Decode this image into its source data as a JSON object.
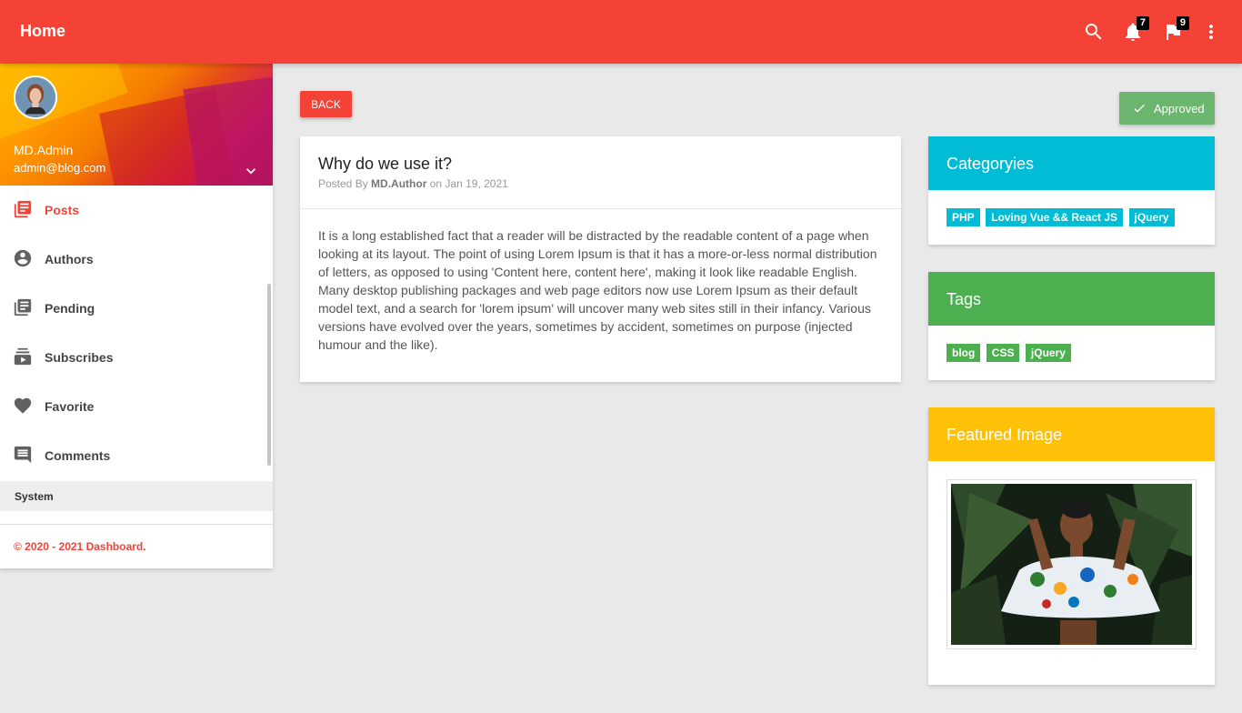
{
  "header": {
    "title": "Home",
    "notifications_count": "7",
    "flags_count": "9",
    "color": "#f44336"
  },
  "user": {
    "name": "MD.Admin",
    "email": "admin@blog.com"
  },
  "sidebar": {
    "items": [
      {
        "label": "Posts",
        "icon": "posts-icon",
        "active": true
      },
      {
        "label": "Authors",
        "icon": "account-circle-icon"
      },
      {
        "label": "Pending",
        "icon": "pending-icon"
      },
      {
        "label": "Subscribes",
        "icon": "subscriptions-icon"
      },
      {
        "label": "Favorite",
        "icon": "heart-icon"
      },
      {
        "label": "Comments",
        "icon": "comment-icon"
      }
    ],
    "section_header": "System",
    "footer": "© 2020 - 2021 Dashboard."
  },
  "actions": {
    "back_label": "BACK",
    "approved_label": "Approved"
  },
  "post": {
    "title": "Why do we use it?",
    "meta_prefix": "Posted By",
    "author": "MD.Author",
    "meta_on": "on",
    "date": "Jan 19, 2021",
    "body": "It is a long established fact that a reader will be distracted by the readable content of a page when looking at its layout. The point of using Lorem Ipsum is that it has a more-or-less normal distribution of letters, as opposed to using 'Content here, content here', making it look like readable English. Many desktop publishing packages and web page editors now use Lorem Ipsum as their default model text, and a search for 'lorem ipsum' will uncover many web sites still in their infancy. Various versions have evolved over the years, sometimes by accident, sometimes on purpose (injected humour and the like)."
  },
  "categories": {
    "title": "Categoryies",
    "color": "#00bcd4",
    "items": [
      "PHP",
      "Loving Vue && React JS",
      "jQuery"
    ]
  },
  "tags": {
    "title": "Tags",
    "color": "#4caf50",
    "items": [
      "blog",
      "CSS",
      "jQuery"
    ]
  },
  "featured": {
    "title": "Featured Image",
    "color": "#ffc107"
  }
}
